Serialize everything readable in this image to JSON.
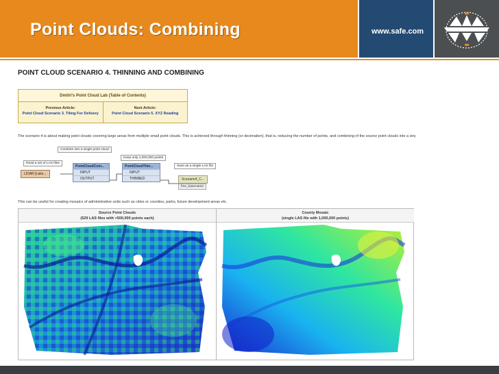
{
  "header": {
    "title": "Point Clouds: Combining",
    "url": "www.safe.com",
    "logo_name": "fme-logo-icon"
  },
  "article": {
    "heading": "POINT CLOUD SCENARIO 4. THINNING AND COMBINING",
    "toc": {
      "title": "Dmitri's Point Cloud Lab (Table of Contents)",
      "prev_label": "Previous Article:",
      "prev_link": "Point Cloud Scenario 3. Tiling For Delivery",
      "next_label": "Next Article:",
      "next_link": "Point Cloud Scenario 5. XYZ Reading"
    },
    "intro": "The scenario 4 is about making point clouds covering large areas from multiple small point clouds. This is achieved through thinning (or decimation), that is, reducing the number of points, and combining of the source point clouds into a sing",
    "note": "This can be useful for creating mosaics of administrative units such as cities or counties, parks, future development areas etc."
  },
  "workflow": {
    "ann_read": "Read a set of LAS files",
    "ann_combine": "Combine into a single point cloud",
    "ann_keep": "Keep only 1,000,000 points",
    "ann_save": "Save as a single LAS file",
    "reader": "LIDAR [Lake...",
    "combiner": {
      "title": "PointCloudCom...",
      "in": "INPUT",
      "out": "OUTPUT"
    },
    "thinner": {
      "title": "PointCloudThin...",
      "in": "INPUT",
      "out": "THINNED"
    },
    "writer": "Scenario4_C...",
    "feature": "fme_basename"
  },
  "images": {
    "left_title": "Source Point Clouds",
    "left_sub": "(529 LAS files with >500,000 points each)",
    "right_title": "County Mosaic",
    "right_sub": "(single LAS file with 1,000,000 points)"
  },
  "colors": {
    "orange": "#e8891d",
    "blue": "#234a72",
    "gray": "#4b4f52"
  }
}
